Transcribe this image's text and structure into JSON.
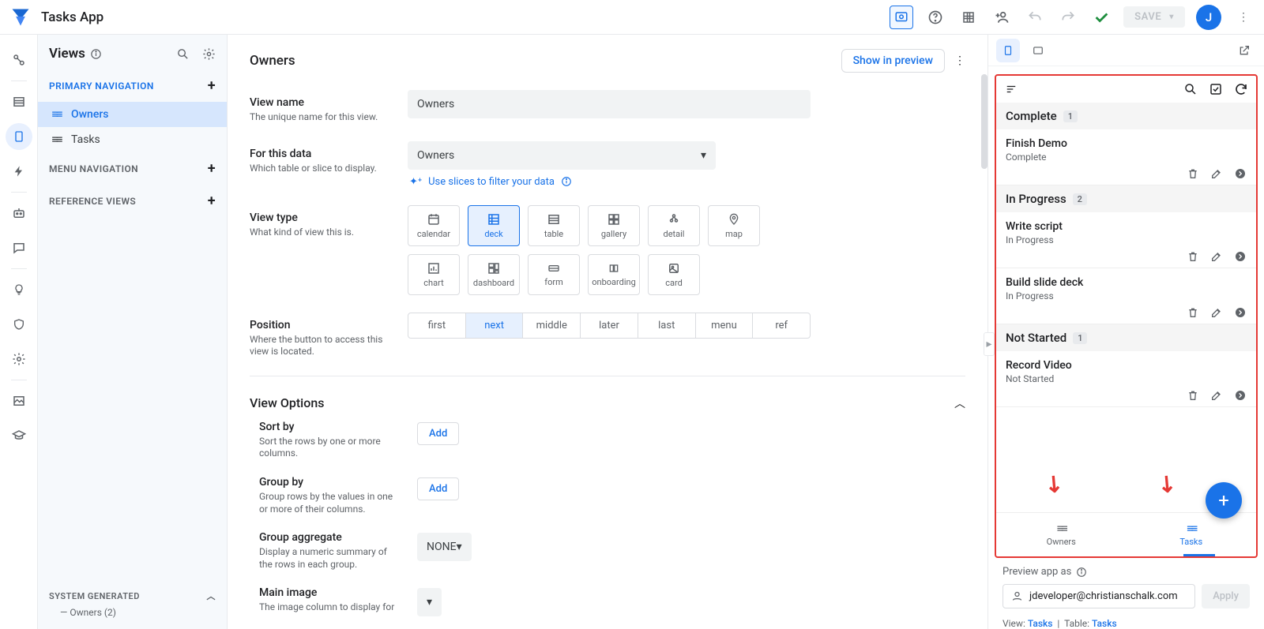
{
  "app": {
    "name": "Tasks App"
  },
  "topbar": {
    "save_label": "SAVE",
    "avatar_initial": "J"
  },
  "views_panel": {
    "title": "Views",
    "sections": {
      "primary": "PRIMARY NAVIGATION",
      "menu": "MENU NAVIGATION",
      "reference": "REFERENCE VIEWS",
      "system": "SYSTEM GENERATED"
    },
    "items": {
      "owners": "Owners",
      "tasks": "Tasks"
    },
    "system_sub": "Owners (2)"
  },
  "center": {
    "page_title": "Owners",
    "show_preview": "Show in preview",
    "view_name": {
      "label": "View name",
      "desc": "The unique name for this view.",
      "value": "Owners"
    },
    "for_data": {
      "label": "For this data",
      "desc": "Which table or slice to display.",
      "value": "Owners",
      "helper": "Use slices to filter your data"
    },
    "view_type": {
      "label": "View type",
      "desc": "What kind of view this is.",
      "options": [
        "calendar",
        "deck",
        "table",
        "gallery",
        "detail",
        "map",
        "chart",
        "dashboard",
        "form",
        "onboarding",
        "card"
      ],
      "selected": "deck"
    },
    "position": {
      "label": "Position",
      "desc": "Where the button to access this view is located.",
      "options": [
        "first",
        "next",
        "middle",
        "later",
        "last",
        "menu",
        "ref"
      ],
      "selected": "next"
    },
    "view_options": {
      "title": "View Options",
      "sort_by": {
        "label": "Sort by",
        "desc": "Sort the rows by one or more columns.",
        "btn": "Add"
      },
      "group_by": {
        "label": "Group by",
        "desc": "Group rows by the values in one or more of their columns.",
        "btn": "Add"
      },
      "group_agg": {
        "label": "Group aggregate",
        "desc": "Display a numeric summary of the rows in each group.",
        "value": "NONE"
      },
      "main_image": {
        "label": "Main image",
        "desc": "The image column to display for",
        "value": ""
      }
    }
  },
  "preview": {
    "groups": [
      {
        "name": "Complete",
        "count": "1",
        "items": [
          {
            "title": "Finish Demo",
            "status": "Complete"
          }
        ]
      },
      {
        "name": "In Progress",
        "count": "2",
        "items": [
          {
            "title": "Write script",
            "status": "In Progress"
          },
          {
            "title": "Build slide deck",
            "status": "In Progress"
          }
        ]
      },
      {
        "name": "Not Started",
        "count": "1",
        "items": [
          {
            "title": "Record Video",
            "status": "Not Started"
          }
        ]
      }
    ],
    "nav": {
      "owners": "Owners",
      "tasks": "Tasks"
    },
    "footer": {
      "label": "Preview app as",
      "email": "jdeveloper@christianschalk.com",
      "apply": "Apply"
    },
    "viewline": {
      "prefix": "View:",
      "view": "Tasks",
      "sep": "|",
      "tprefix": "Table:",
      "table": "Tasks"
    }
  }
}
